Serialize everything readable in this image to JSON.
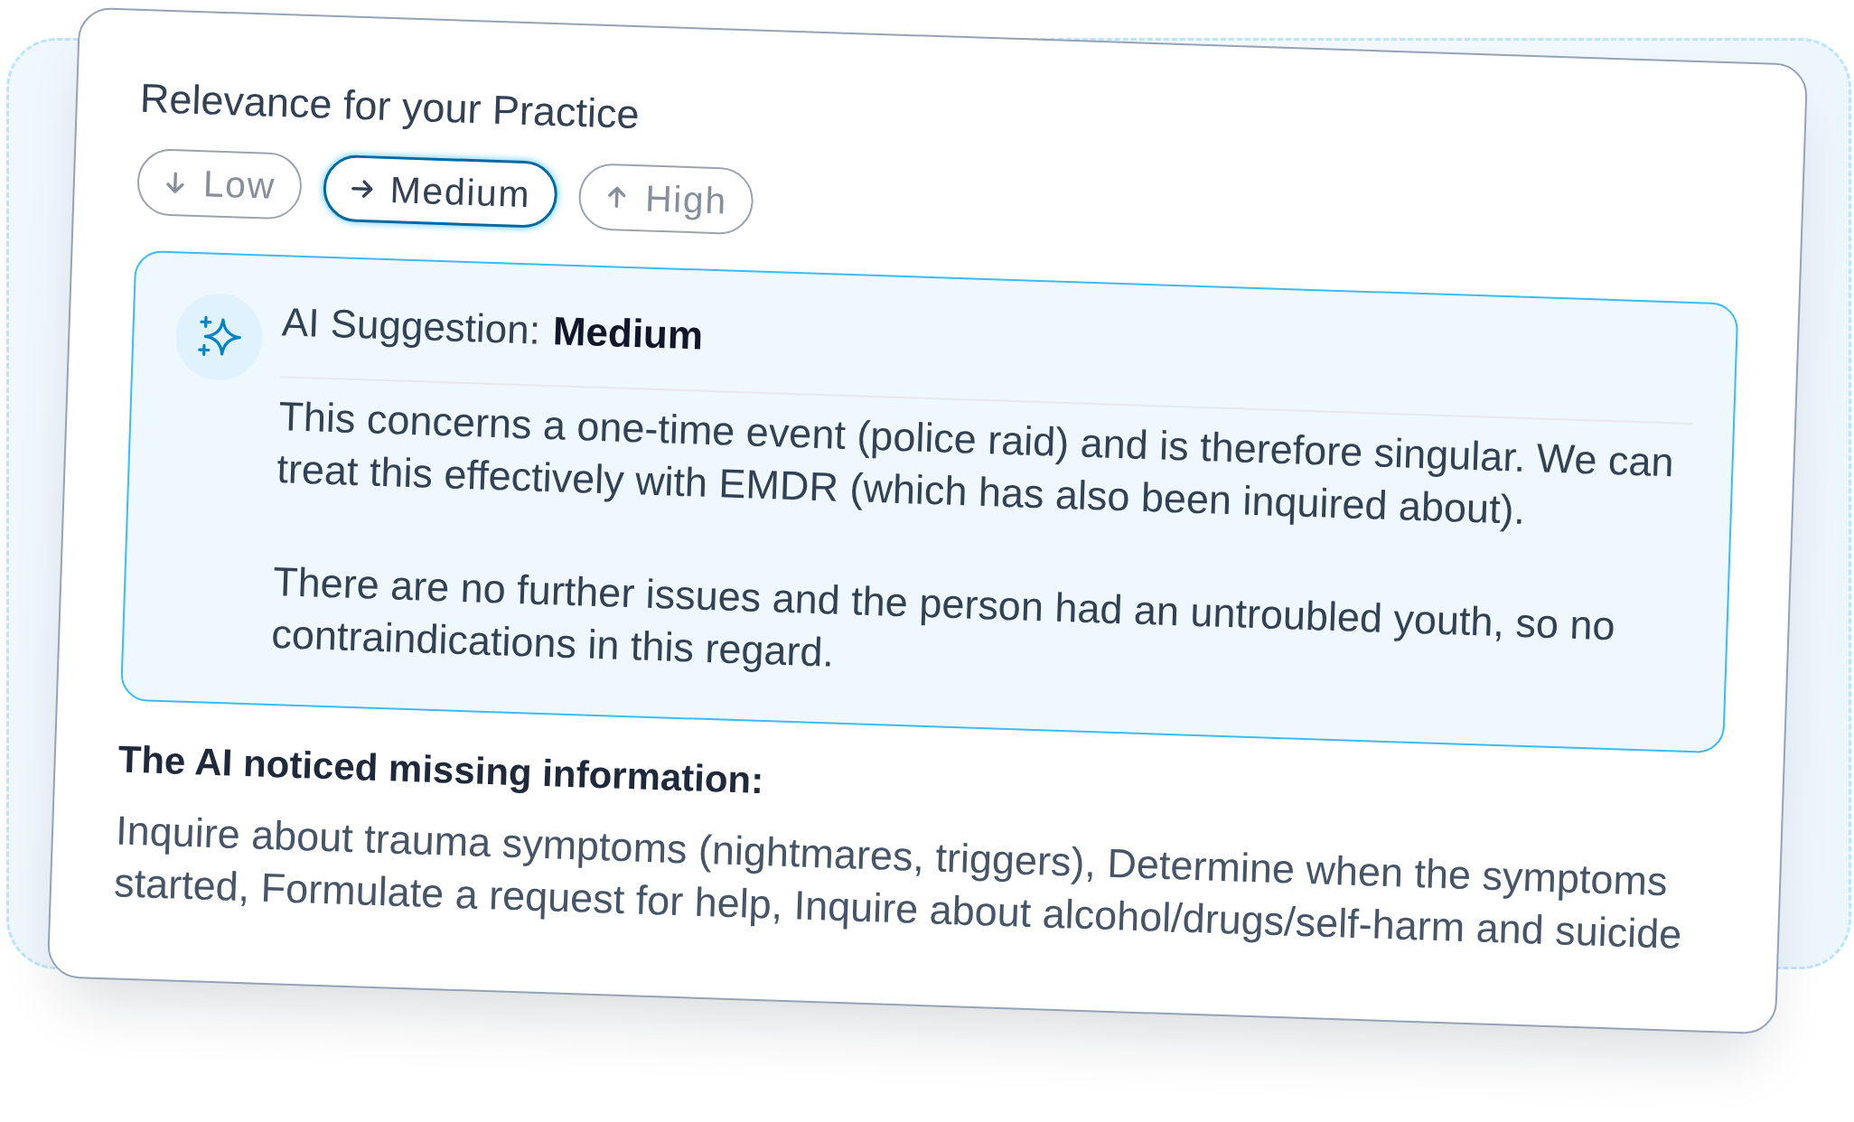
{
  "card": {
    "title": "Relevance for your Practice",
    "options": [
      {
        "label": "Low",
        "kind": "low",
        "selected": false
      },
      {
        "label": "Medium",
        "kind": "medium",
        "selected": true
      },
      {
        "label": "High",
        "kind": "high",
        "selected": false
      }
    ],
    "suggestion": {
      "label": "AI Suggestion:",
      "value": "Medium",
      "paragraphs": [
        "This concerns a one-time event (police raid) and is therefore singular. We can treat this effectively with EMDR (which has also been inquired about).",
        "There are no further issues and the person had an untroubled youth, so no contraindications in this regard."
      ]
    },
    "missing_info": {
      "title": "The AI noticed missing information:",
      "text": "Inquire about trauma symptoms (nightmares, triggers), Determine when the symptoms started, Formulate a request for help, Inquire about alcohol/drugs/self-harm and suicide"
    }
  }
}
